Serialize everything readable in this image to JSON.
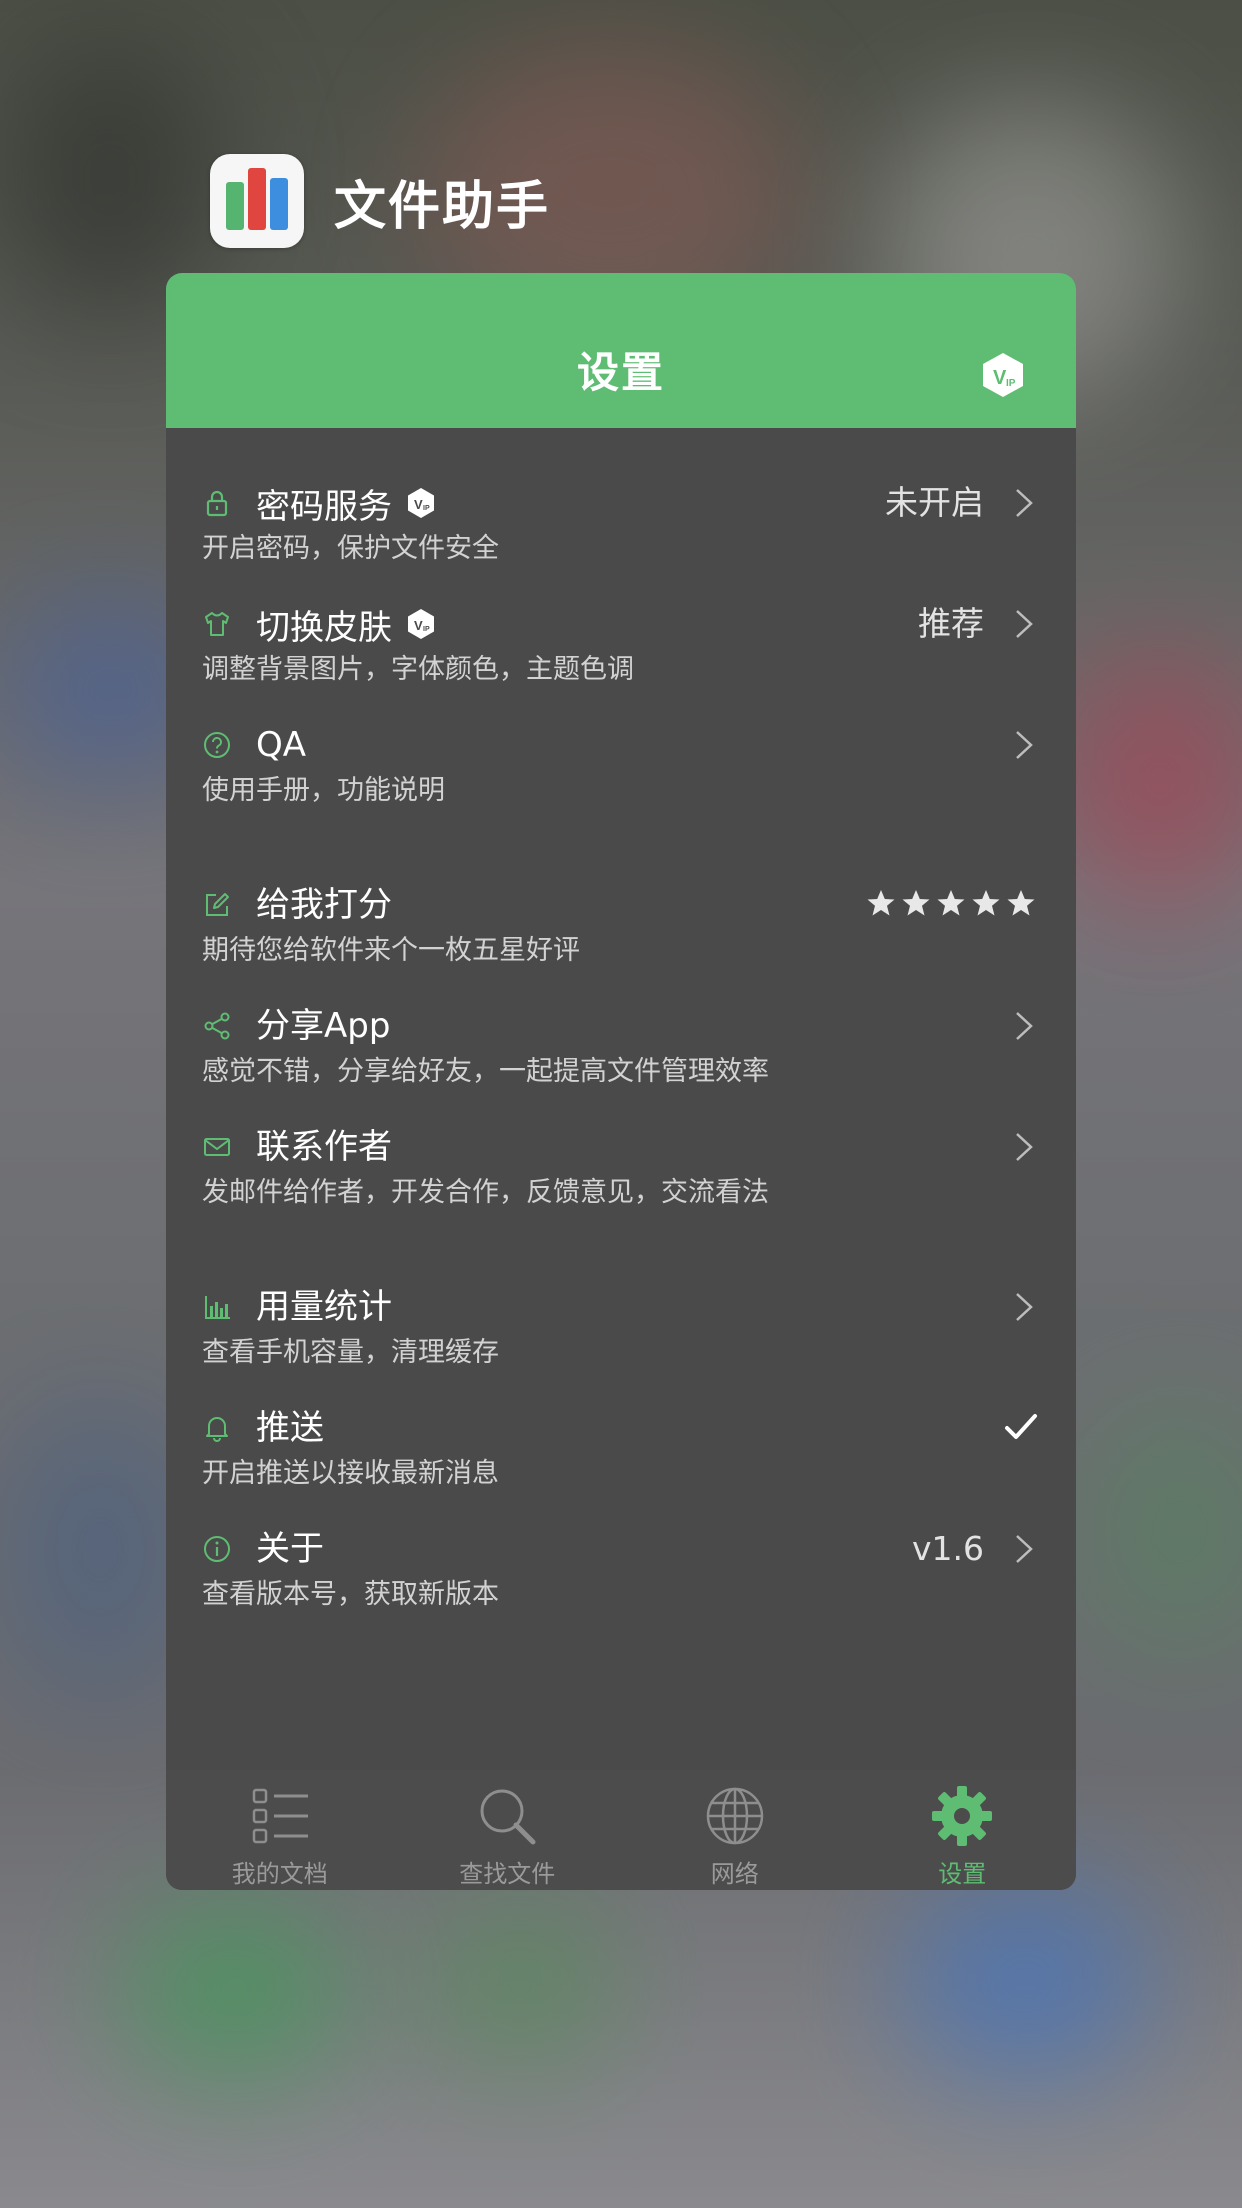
{
  "app": {
    "name": "文件助手"
  },
  "header": {
    "title": "设置"
  },
  "colors": {
    "accent": "#5ebd73",
    "card_bg": "#4a4a4a",
    "text": "#ffffff",
    "subtext": "#d2d2d2"
  },
  "items": [
    {
      "icon": "lock-icon",
      "title": "密码服务",
      "subtitle": "开启密码，保护文件安全",
      "value": "未开启",
      "vip": true,
      "trailing": "chevron"
    },
    {
      "icon": "tshirt-icon",
      "title": "切换皮肤",
      "subtitle": "调整背景图片，字体颜色，主题色调",
      "value": "推荐",
      "vip": true,
      "trailing": "chevron"
    },
    {
      "icon": "question-icon",
      "title": "QA",
      "subtitle": "使用手册，功能说明",
      "trailing": "chevron"
    },
    {
      "icon": "edit-icon",
      "title": "给我打分",
      "subtitle": "期待您给软件来个一枚五星好评",
      "trailing": "stars",
      "rating": 5
    },
    {
      "icon": "share-icon",
      "title": "分享App",
      "subtitle": "感觉不错，分享给好友，一起提高文件管理效率",
      "trailing": "chevron"
    },
    {
      "icon": "mail-icon",
      "title": "联系作者",
      "subtitle": "发邮件给作者，开发合作，反馈意见，交流看法",
      "trailing": "chevron"
    },
    {
      "icon": "bar-chart-icon",
      "title": "用量统计",
      "subtitle": "查看手机容量，清理缓存",
      "trailing": "chevron"
    },
    {
      "icon": "bell-icon",
      "title": "推送",
      "subtitle": "开启推送以接收最新消息",
      "trailing": "check"
    },
    {
      "icon": "info-icon",
      "title": "关于",
      "subtitle": "查看版本号，获取新版本",
      "value": "v1.6",
      "trailing": "chevron"
    }
  ],
  "tabs": [
    {
      "icon": "list-icon",
      "label": "我的文档",
      "active": false
    },
    {
      "icon": "search-icon",
      "label": "查找文件",
      "active": false
    },
    {
      "icon": "globe-icon",
      "label": "网络",
      "active": false
    },
    {
      "icon": "gear-icon",
      "label": "设置",
      "active": true
    }
  ]
}
